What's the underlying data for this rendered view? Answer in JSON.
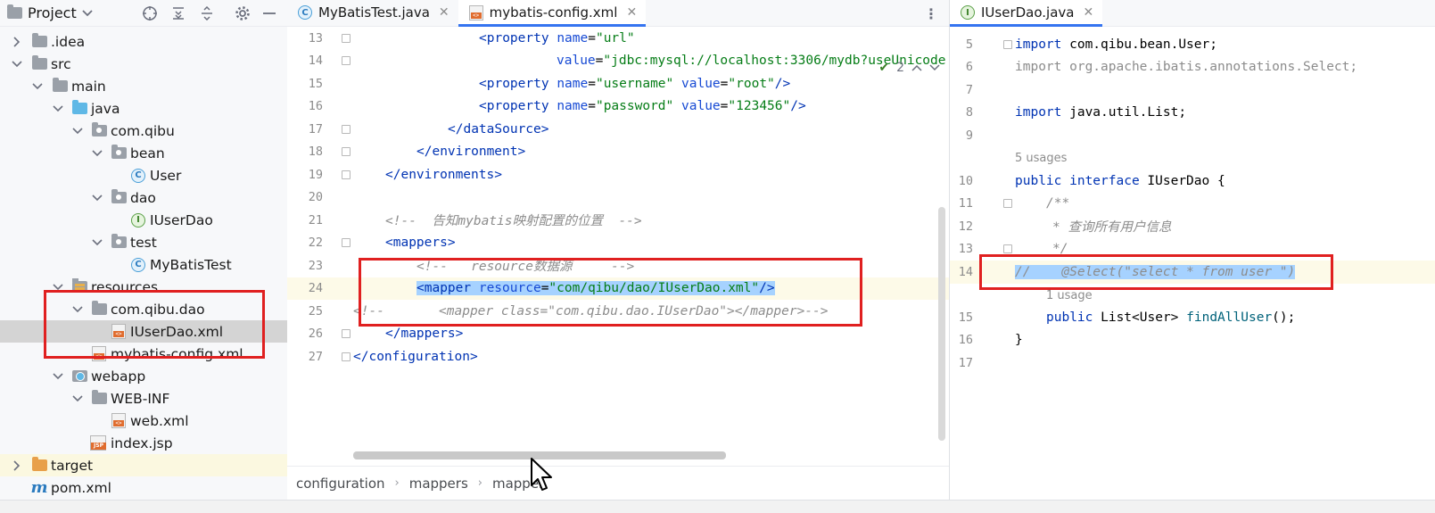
{
  "project_panel": {
    "title": "Project",
    "tree": [
      {
        "label": ".idea",
        "icon": "folder-icon",
        "expanded": false
      },
      {
        "label": "src",
        "icon": "folder-icon",
        "expanded": true
      },
      {
        "label": "main",
        "icon": "folder-icon",
        "expanded": true
      },
      {
        "label": "java",
        "icon": "source-folder-icon",
        "expanded": true
      },
      {
        "label": "com.qibu",
        "icon": "package-icon",
        "expanded": true
      },
      {
        "label": "bean",
        "icon": "package-icon",
        "expanded": true
      },
      {
        "label": "User",
        "icon": "class-icon"
      },
      {
        "label": "dao",
        "icon": "package-icon",
        "expanded": true
      },
      {
        "label": "IUserDao",
        "icon": "interface-icon"
      },
      {
        "label": "test",
        "icon": "package-icon",
        "expanded": true
      },
      {
        "label": "MyBatisTest",
        "icon": "class-icon"
      },
      {
        "label": "resources",
        "icon": "resources-folder-icon",
        "expanded": true
      },
      {
        "label": "com.qibu.dao",
        "icon": "folder-icon",
        "expanded": true
      },
      {
        "label": "IUserDao.xml",
        "icon": "xml-file-icon",
        "selected": true
      },
      {
        "label": "mybatis-config.xml",
        "icon": "xml-file-icon"
      },
      {
        "label": "webapp",
        "icon": "web-folder-icon",
        "expanded": true
      },
      {
        "label": "WEB-INF",
        "icon": "folder-icon",
        "expanded": true
      },
      {
        "label": "web.xml",
        "icon": "web-xml-icon"
      },
      {
        "label": "index.jsp",
        "icon": "jsp-file-icon"
      },
      {
        "label": "target",
        "icon": "excluded-folder-icon",
        "expanded": false
      },
      {
        "label": "pom.xml",
        "icon": "maven-icon"
      }
    ]
  },
  "editor_left": {
    "tabs": [
      {
        "label": "MyBatisTest.java",
        "active": false
      },
      {
        "label": "mybatis-config.xml",
        "active": true
      }
    ],
    "inspection": {
      "count": "2"
    },
    "lines": [
      {
        "n": "13",
        "code": "<property name=\"url\""
      },
      {
        "n": "14",
        "code": "value=\"jdbc:mysql://localhost:3306/mydb?useUnicode"
      },
      {
        "n": "15",
        "code": "<property name=\"username\" value=\"root\"/>"
      },
      {
        "n": "16",
        "code": "<property name=\"password\" value=\"123456\"/>"
      },
      {
        "n": "17",
        "code": "</dataSource>"
      },
      {
        "n": "18",
        "code": "</environment>"
      },
      {
        "n": "19",
        "code": "</environments>"
      },
      {
        "n": "20",
        "code": ""
      },
      {
        "n": "21",
        "code": "<!--  告知mybatis映射配置的位置  -->"
      },
      {
        "n": "22",
        "code": "<mappers>"
      },
      {
        "n": "23",
        "code": "<!--   resource数据源     -->"
      },
      {
        "n": "24",
        "code": "<mapper resource=\"com/qibu/dao/IUserDao.xml\"/>"
      },
      {
        "n": "25",
        "code": "<!--       <mapper class=\"com.qibu.dao.IUserDao\"></mapper>-->"
      },
      {
        "n": "26",
        "code": "</mappers>"
      },
      {
        "n": "27",
        "code": "</configuration>"
      }
    ],
    "breadcrumbs": [
      "configuration",
      "mappers",
      "mapper"
    ]
  },
  "editor_right": {
    "tabs": [
      {
        "label": "IUserDao.java",
        "active": true
      }
    ],
    "lines": [
      {
        "n": "5",
        "code": "import com.qibu.bean.User;"
      },
      {
        "n": "6",
        "code": "import org.apache.ibatis.annotations.Select;"
      },
      {
        "n": "7",
        "code": ""
      },
      {
        "n": "8",
        "code": "import java.util.List;"
      },
      {
        "n": "9",
        "code": ""
      },
      {
        "n": "",
        "code": "5 usages"
      },
      {
        "n": "10",
        "code": "public interface IUserDao {"
      },
      {
        "n": "11",
        "code": "/**"
      },
      {
        "n": "12",
        "code": "* 查询所有用户信息"
      },
      {
        "n": "13",
        "code": "*/"
      },
      {
        "n": "14",
        "code": "//    @Select(\"select * from user \")"
      },
      {
        "n": "",
        "code": "1 usage"
      },
      {
        "n": "15",
        "code": "public List<User> findAllUser();"
      },
      {
        "n": "16",
        "code": "}"
      },
      {
        "n": "17",
        "code": ""
      }
    ]
  },
  "colors": {
    "tag": "#0033b3",
    "attribute": "#174ad4",
    "string": "#067d17",
    "comment": "#8c8c8c",
    "selection": "#a6d2ff",
    "highlight_box": "#e02020",
    "active_tab_underline": "#3574f0"
  }
}
